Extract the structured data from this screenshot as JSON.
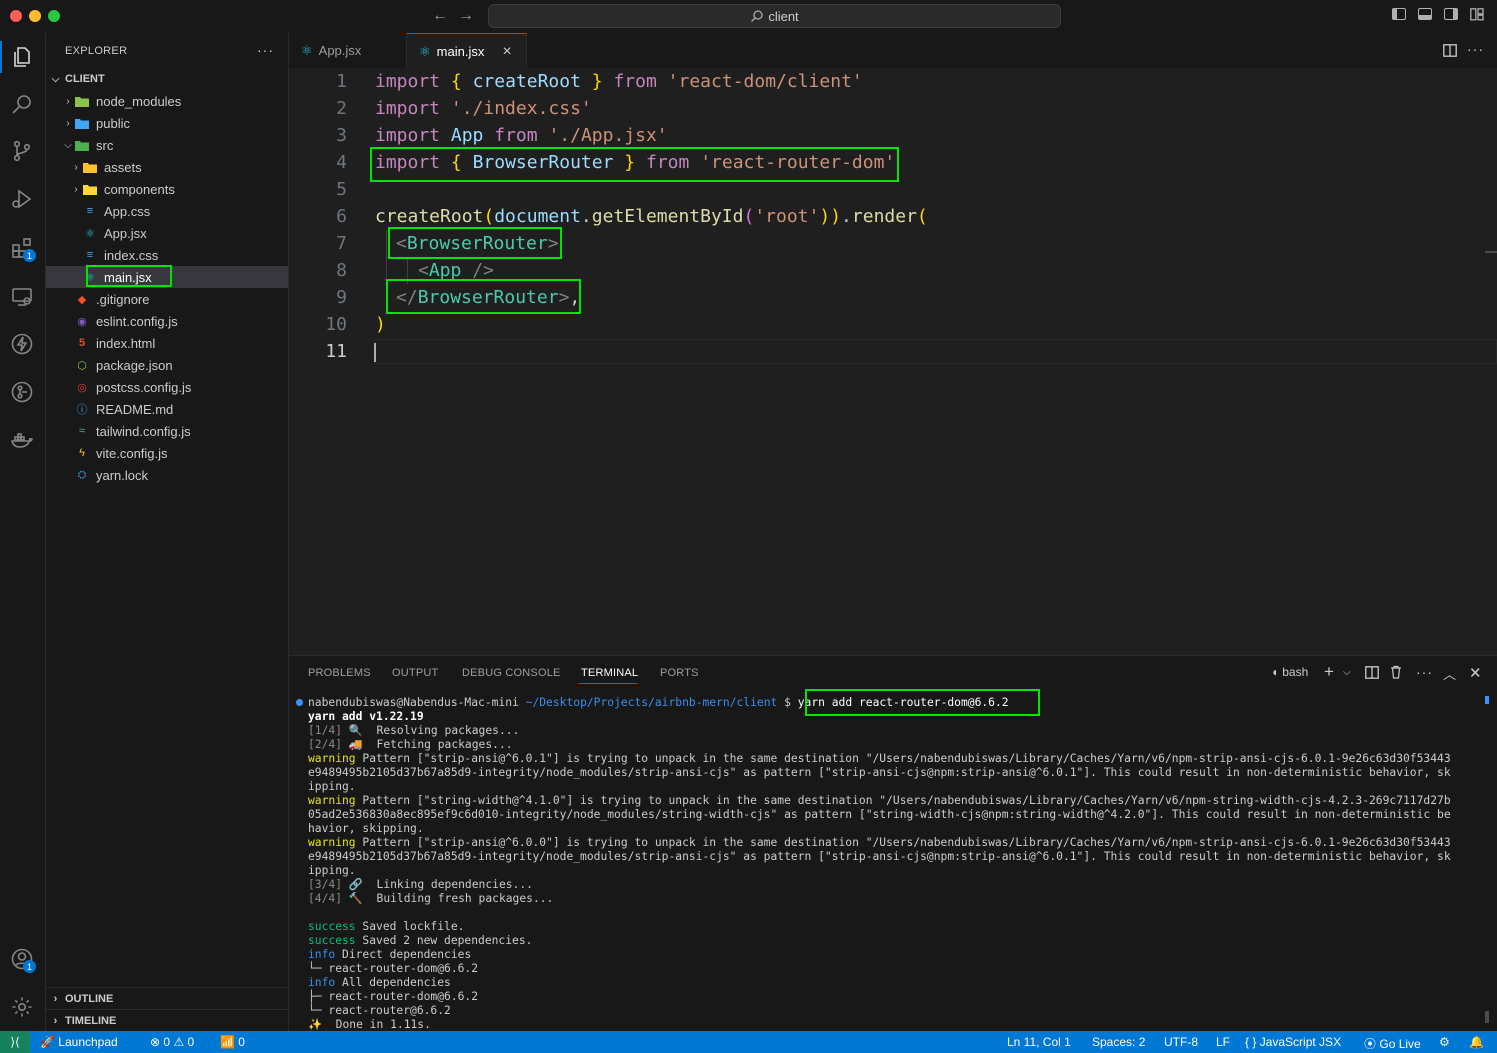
{
  "titlebar": {
    "search_text": "client"
  },
  "explorer": {
    "title": "EXPLORER",
    "more": "···",
    "root_label": "CLIENT",
    "items": [
      {
        "label": "node_modules"
      },
      {
        "label": "public"
      },
      {
        "label": "src"
      },
      {
        "label": "assets"
      },
      {
        "label": "components"
      },
      {
        "label": "App.css"
      },
      {
        "label": "App.jsx"
      },
      {
        "label": "index.css"
      },
      {
        "label": "main.jsx"
      },
      {
        "label": ".gitignore"
      },
      {
        "label": "eslint.config.js"
      },
      {
        "label": "index.html"
      },
      {
        "label": "package.json"
      },
      {
        "label": "postcss.config.js"
      },
      {
        "label": "README.md"
      },
      {
        "label": "tailwind.config.js"
      },
      {
        "label": "vite.config.js"
      },
      {
        "label": "yarn.lock"
      }
    ],
    "outline_label": "OUTLINE",
    "timeline_label": "TIMELINE"
  },
  "activity": {
    "extensions_badge": "1",
    "accounts_badge": "1"
  },
  "tabs": [
    {
      "label": "App.jsx"
    },
    {
      "label": "main.jsx",
      "close": "×"
    }
  ],
  "editor": {
    "line_numbers": [
      "1",
      "2",
      "3",
      "4",
      "5",
      "6",
      "7",
      "8",
      "9",
      "10",
      "11"
    ],
    "code": {
      "l1": {
        "import": "import",
        "ob": "{",
        "name": "createRoot",
        "cb": "}",
        "from": "from",
        "src": "'react-dom/client'"
      },
      "l2": {
        "import": "import",
        "src": "'./index.css'"
      },
      "l3": {
        "import": "import",
        "name": "App",
        "from": "from",
        "src": "'./App.jsx'"
      },
      "l4": {
        "import": "import",
        "ob": "{",
        "name": "BrowserRouter",
        "cb": "}",
        "from": "from",
        "src": "'react-router-dom'"
      },
      "l6": {
        "fn": "createRoot",
        "p1": "(",
        "obj": "document",
        "dot": ".",
        "method": "getElementById",
        "p2": "(",
        "arg": "'root'",
        "p3": "))",
        "dot2": ".",
        "render": "render",
        "p4": "("
      },
      "l7": {
        "lt": "<",
        "tag": "BrowserRouter",
        "gt": ">"
      },
      "l8": {
        "lt": "<",
        "tag": "App",
        "end": " />"
      },
      "l9": {
        "lt": "</",
        "tag": "BrowserRouter",
        "gt": ">",
        "comma": ","
      },
      "l10": {
        "p": ")"
      }
    }
  },
  "panel": {
    "tabs": [
      "PROBLEMS",
      "OUTPUT",
      "DEBUG CONSOLE",
      "TERMINAL",
      "PORTS"
    ],
    "shell": "bash",
    "prompt": {
      "user": "nabendubiswas@Nabendus-Mac-mini",
      "path": "~/Desktop/Projects/airbnb-mern/client",
      "dollar": "$",
      "command": "yarn add react-router-dom@6.6.2"
    },
    "lines": {
      "yarn_version": "yarn add v1.22.19",
      "s1_step": "[1/4]",
      "s1_icon": "🔍",
      "s1_text": "Resolving packages...",
      "s2_step": "[2/4]",
      "s2_icon": "🚚",
      "s2_text": "Fetching packages...",
      "w1_kw": "warning",
      "w1_a": " Pattern [\"strip-ansi@^6.0.1\"] is trying to unpack in the same destination \"/Users/nabendubiswas/Library/Caches/Yarn/v6/npm-strip-ansi-cjs-6.0.1-9e26c63d30f53443",
      "w1_b": "e9489495b2105d37b67a85d9-integrity/node_modules/strip-ansi-cjs\" as pattern [\"strip-ansi-cjs@npm:strip-ansi@^6.0.1\"]. This could result in non-deterministic behavior, sk",
      "w1_c": "ipping.",
      "w2_kw": "warning",
      "w2_a": " Pattern [\"string-width@^4.1.0\"] is trying to unpack in the same destination \"/Users/nabendubiswas/Library/Caches/Yarn/v6/npm-string-width-cjs-4.2.3-269c7117d27b",
      "w2_b": "05ad2e536830a8ec895ef9c6d010-integrity/node_modules/string-width-cjs\" as pattern [\"string-width-cjs@npm:string-width@^4.2.0\"]. This could result in non-deterministic be",
      "w2_c": "havior, skipping.",
      "w3_kw": "warning",
      "w3_a": " Pattern [\"strip-ansi@^6.0.0\"] is trying to unpack in the same destination \"/Users/nabendubiswas/Library/Caches/Yarn/v6/npm-strip-ansi-cjs-6.0.1-9e26c63d30f53443",
      "w3_b": "e9489495b2105d37b67a85d9-integrity/node_modules/strip-ansi-cjs\" as pattern [\"strip-ansi-cjs@npm:strip-ansi@^6.0.1\"]. This could result in non-deterministic behavior, sk",
      "w3_c": "ipping.",
      "s3_step": "[3/4]",
      "s3_icon": "🔗",
      "s3_text": "Linking dependencies...",
      "s4_step": "[4/4]",
      "s4_icon": "🔨",
      "s4_text": "Building fresh packages...",
      "ok1_kw": "success",
      "ok1_text": " Saved lockfile.",
      "ok2_kw": "success",
      "ok2_text": " Saved 2 new dependencies.",
      "i1_kw": "info",
      "i1_text": " Direct dependencies",
      "d1": "└─ react-router-dom@6.6.2",
      "i2_kw": "info",
      "i2_text": " All dependencies",
      "d2": "├─ react-router-dom@6.6.2",
      "d3": "└─ react-router@6.6.2",
      "done_icon": "✨",
      "done_text": "  Done in 1.11s."
    }
  },
  "statusbar": {
    "launchpad": "Launchpad",
    "errors": "0",
    "warnings": "0",
    "ports": "0",
    "cursor": "Ln 11, Col 1",
    "spaces": "Spaces: 2",
    "encoding": "UTF-8",
    "eol": "LF",
    "language": "JavaScript JSX",
    "golive": "Go Live"
  },
  "colors": {
    "accent": "#0078d4",
    "highlight_box": "#00e600",
    "keyword": "#c586c0",
    "string": "#ce9178",
    "variable": "#9cdcfe",
    "jsx_tag": "#4ec9b0"
  }
}
